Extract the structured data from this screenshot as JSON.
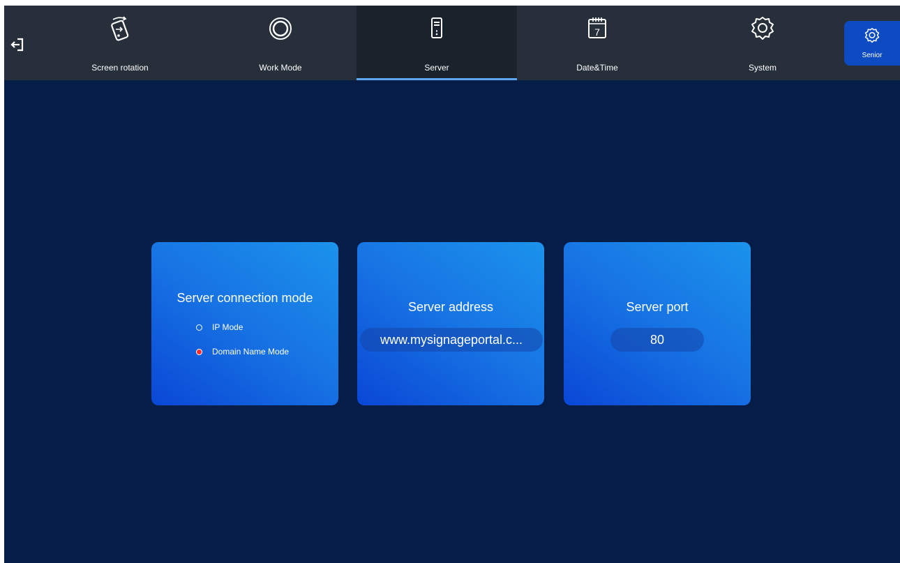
{
  "topbar": {
    "exit_icon": "exit-icon",
    "tabs": [
      {
        "label": "Screen rotation",
        "icon": "screen-rotation-icon"
      },
      {
        "label": "Work Mode",
        "icon": "work-mode-icon"
      },
      {
        "label": "Server",
        "icon": "server-icon",
        "active": true
      },
      {
        "label": "Date&Time",
        "icon": "calendar-icon",
        "day": "7"
      },
      {
        "label": "System",
        "icon": "gear-icon"
      }
    ],
    "senior": {
      "label": "Senior",
      "icon": "gear-icon"
    }
  },
  "cards": {
    "connection_mode": {
      "title": "Server connection mode",
      "options": [
        {
          "label": "IP Mode",
          "selected": false
        },
        {
          "label": "Domain Name Mode",
          "selected": true
        }
      ]
    },
    "address": {
      "title": "Server address",
      "value": "www.mysignageportal.c..."
    },
    "port": {
      "title": "Server port",
      "value": "80"
    }
  },
  "colors": {
    "background": "#061d48",
    "topbar": "#272f3b",
    "active_tab": "#1a222c",
    "underline": "#5aa9f0",
    "accent": "#0d4bc2",
    "radio_selected": "#ff2a2a"
  }
}
